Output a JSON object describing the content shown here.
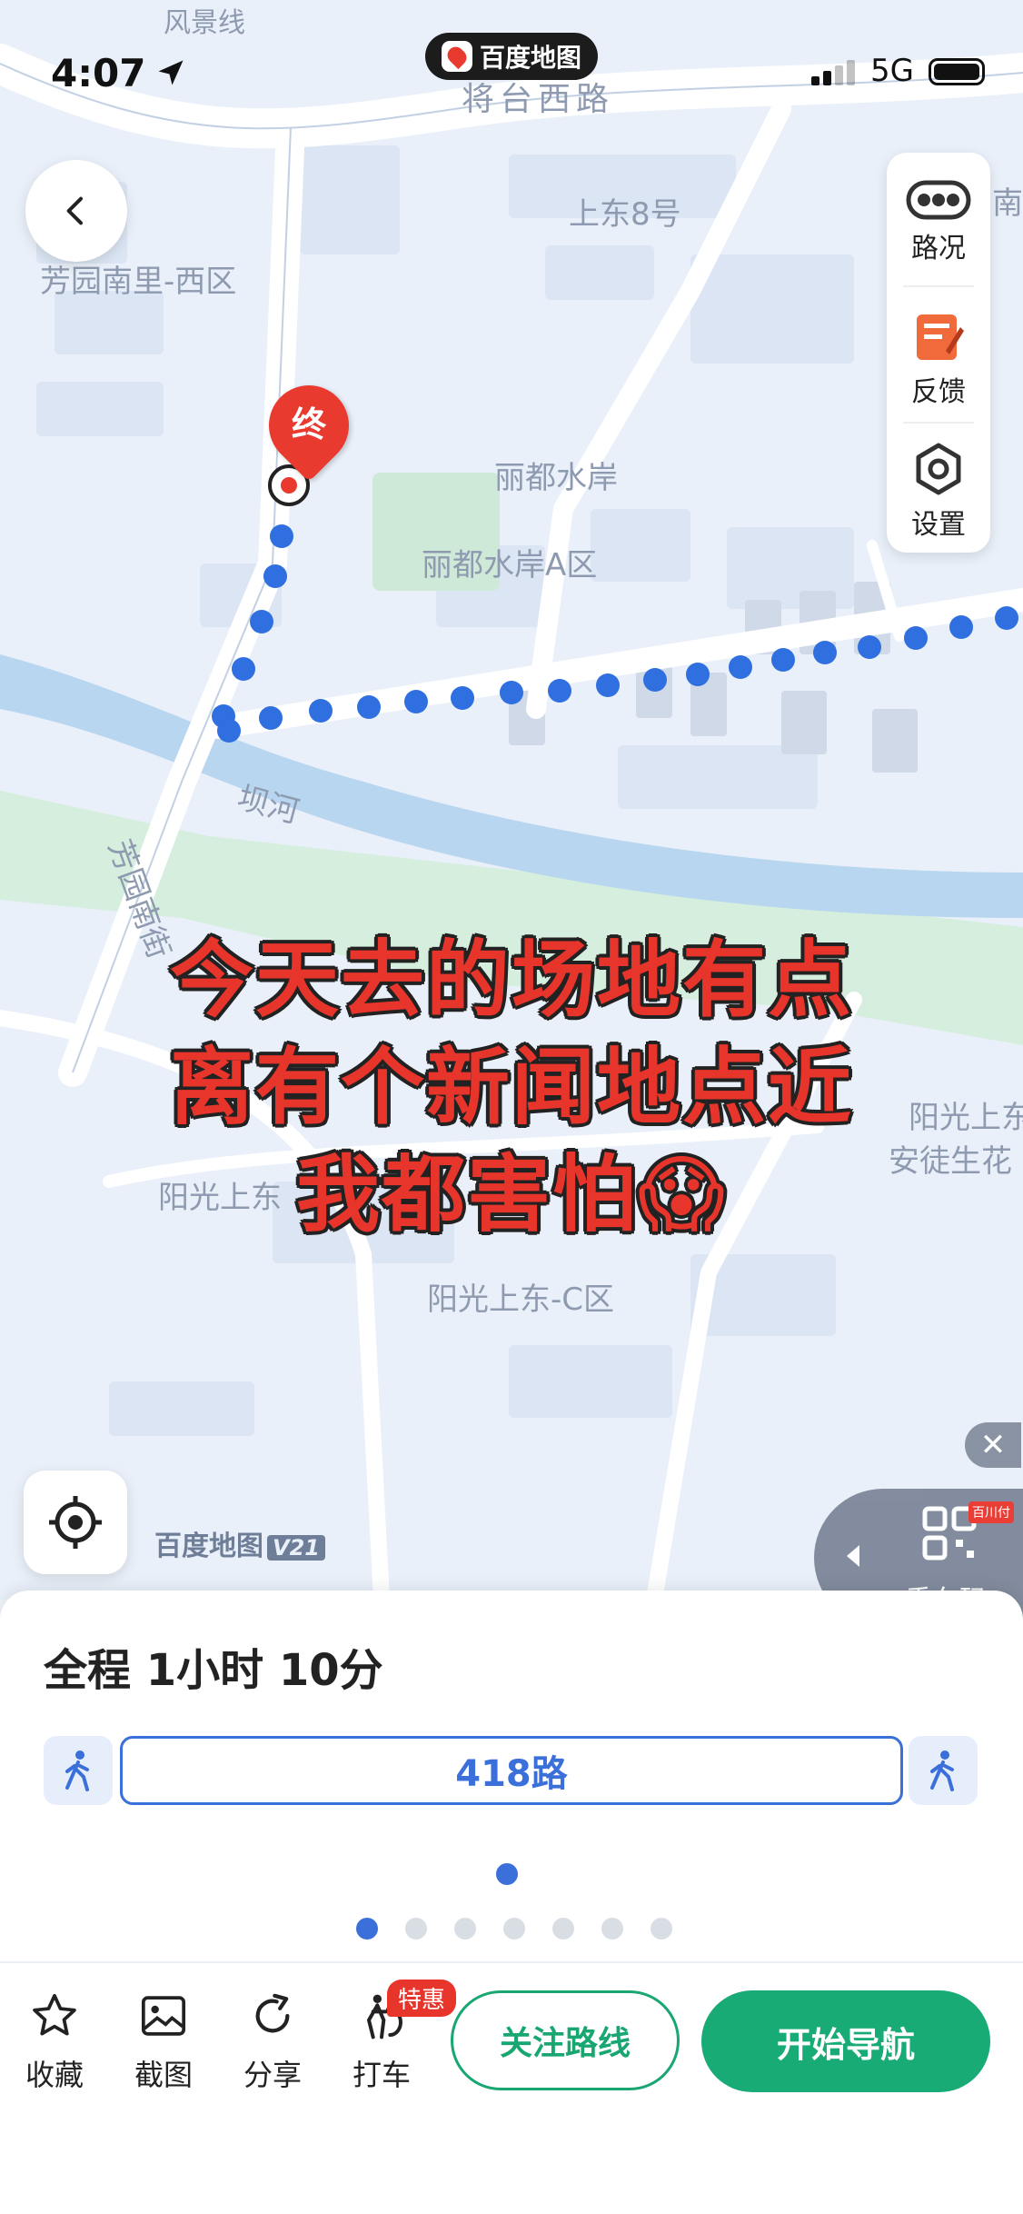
{
  "status_bar": {
    "time": "4:07",
    "network": "5G",
    "app_name": "百度地图"
  },
  "map": {
    "labels": {
      "road_top": "将台西路",
      "area_top_left": "芳园南里-西区",
      "building_top": "上东8号",
      "partial_top_right": "南里",
      "partial_top": "风景线",
      "complex1": "丽都水岸",
      "complex2": "丽都水岸A区",
      "river": "坝河",
      "street": "芳园南街",
      "sunshine1": "阳光上东",
      "sunshine_c": "阳光上东-C区",
      "right_partial1": "阳光上东",
      "right_partial2": "安徒生花"
    },
    "end_marker": "终",
    "watermark_brand": "百度地图",
    "watermark_version": "V21"
  },
  "toolbar": {
    "traffic": "路况",
    "feedback": "反馈",
    "settings": "设置"
  },
  "overlay_text": [
    "今天去的场地有点",
    "离有个新闻地点近",
    "我都害怕😱"
  ],
  "ride_code": {
    "label": "乘车码",
    "badge": "百川付"
  },
  "close_symbol": "✕",
  "sheet": {
    "total_time": "全程 1小时 10分",
    "route": "418路",
    "page_count": 7,
    "active_page": 0
  },
  "actions": {
    "favorite": "收藏",
    "screenshot": "截图",
    "share": "分享",
    "taxi": "打车",
    "taxi_badge": "特惠",
    "follow_route": "关注路线",
    "start_nav": "开始导航"
  },
  "colors": {
    "route": "#2f6fe0",
    "accent_green": "#19ab75",
    "overlay_red": "#e8352c",
    "marker_red": "#e83a2f"
  }
}
